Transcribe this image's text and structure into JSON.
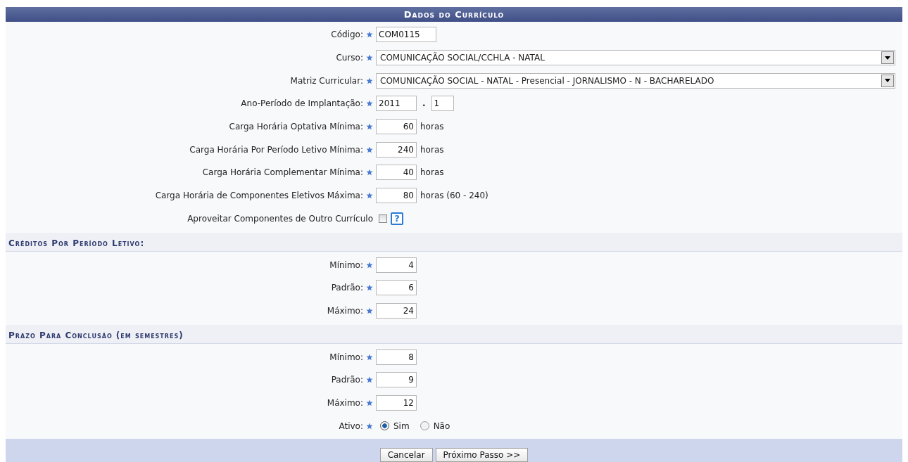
{
  "title": "Dados do Currículo",
  "sections": [
    {
      "fields": [
        {
          "kind": "text",
          "label": "Código:",
          "required": true,
          "value": "COM0115"
        },
        {
          "kind": "select",
          "label": "Curso:",
          "required": true,
          "value": "COMUNICAÇÃO SOCIAL/CCHLA - NATAL"
        },
        {
          "kind": "select",
          "label": "Matriz Curricular:",
          "required": true,
          "value": "COMUNICAÇÃO SOCIAL - NATAL - Presencial - JORNALISMO - N - BACHARELADO"
        },
        {
          "kind": "period",
          "label": "Ano-Período de Implantação:",
          "required": true,
          "year": "2011",
          "separator": ".",
          "period": "1"
        },
        {
          "kind": "number",
          "label": "Carga Horária Optativa Mínima:",
          "required": true,
          "value": "60",
          "suffix": "horas"
        },
        {
          "kind": "number",
          "label": "Carga Horária Por Período Letivo Mínima:",
          "required": true,
          "value": "240",
          "suffix": "horas"
        },
        {
          "kind": "number",
          "label": "Carga Horária Complementar Mínima:",
          "required": true,
          "value": "40",
          "suffix": "horas"
        },
        {
          "kind": "number",
          "label": "Carga Horária de Componentes Eletivos Máxima:",
          "required": true,
          "value": "80",
          "suffix": "horas (60 - 240)"
        },
        {
          "kind": "checkbox",
          "label": "Aproveitar Componentes de Outro Currículo",
          "required": false,
          "checked": false,
          "help": "?"
        }
      ]
    },
    {
      "heading": "Créditos Por Período Letivo:",
      "fields": [
        {
          "kind": "number",
          "label": "Mínimo:",
          "required": true,
          "value": "4"
        },
        {
          "kind": "number",
          "label": "Padrão:",
          "required": true,
          "value": "6"
        },
        {
          "kind": "number",
          "label": "Máximo:",
          "required": true,
          "value": "24"
        }
      ]
    },
    {
      "heading": "Prazo Para Conclusão (em semestres)",
      "fields": [
        {
          "kind": "number",
          "label": "Mínimo:",
          "required": true,
          "value": "8"
        },
        {
          "kind": "number",
          "label": "Padrão:",
          "required": true,
          "value": "9"
        },
        {
          "kind": "number",
          "label": "Máximo:",
          "required": true,
          "value": "12"
        },
        {
          "kind": "radio",
          "label": "Ativo:",
          "required": true,
          "options": [
            {
              "label": "Sim",
              "selected": true
            },
            {
              "label": "Não",
              "selected": false
            }
          ]
        }
      ]
    }
  ],
  "buttons": [
    "Cancelar",
    "Próximo Passo >>"
  ]
}
